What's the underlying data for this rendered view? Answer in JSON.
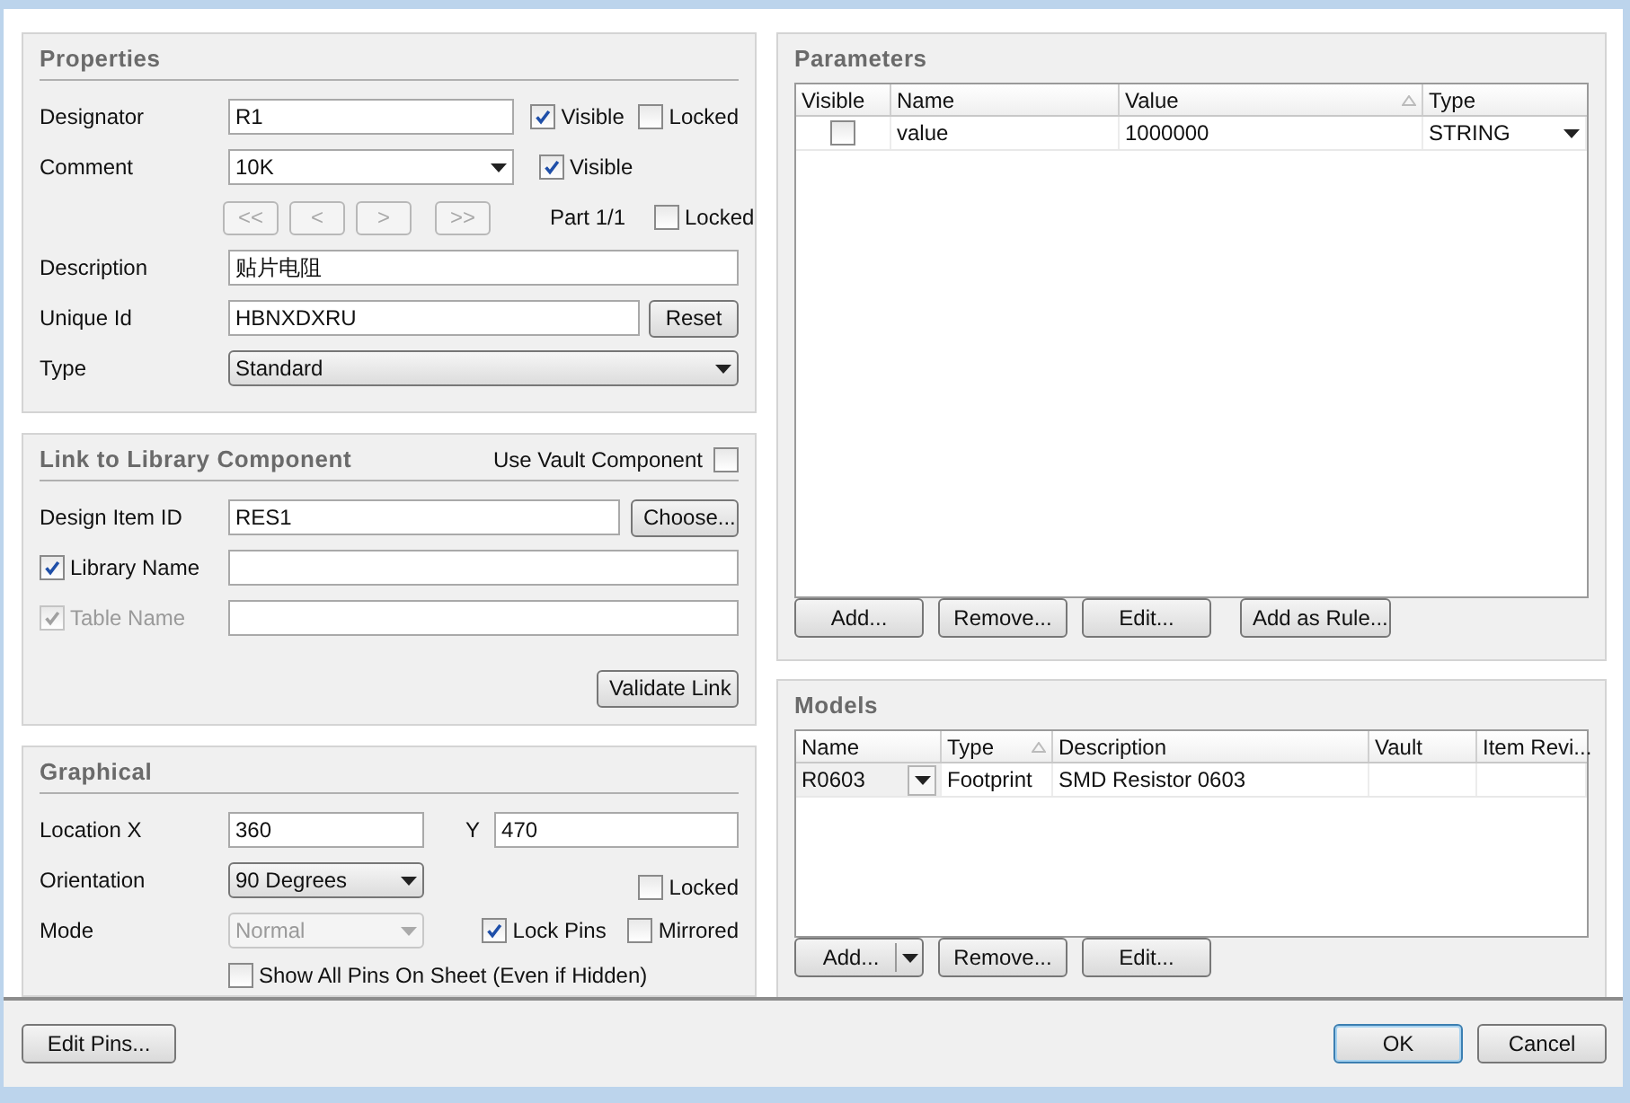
{
  "properties": {
    "title": "Properties",
    "designator": {
      "label": "Designator",
      "value": "R1"
    },
    "designator_visible": {
      "label": "Visible",
      "checked": true
    },
    "designator_locked": {
      "label": "Locked",
      "checked": false
    },
    "comment": {
      "label": "Comment",
      "value": "10K"
    },
    "comment_visible": {
      "label": "Visible",
      "checked": true
    },
    "part_buttons": [
      {
        "label": "<<",
        "disabled": true
      },
      {
        "label": "<",
        "disabled": true
      },
      {
        "label": ">",
        "disabled": true
      },
      {
        "label": ">>",
        "disabled": true
      }
    ],
    "part": "Part 1/1",
    "part_locked": {
      "label": "Locked",
      "checked": false
    },
    "description": {
      "label": "Description",
      "value": "贴片电阻"
    },
    "unique_id": {
      "label": "Unique Id",
      "value": "HBNXDXRU",
      "button": "Reset"
    },
    "type": {
      "label": "Type",
      "value": "Standard"
    }
  },
  "library_link": {
    "title": "Link to Library Component",
    "use_vault": {
      "label": "Use Vault Component",
      "checked": false
    },
    "design_item_id": {
      "label": "Design Item ID",
      "value": "RES1",
      "button": "Choose..."
    },
    "library_name": {
      "label": "Library Name",
      "checked": true
    },
    "table_name": {
      "label": "Table Name",
      "checked": true,
      "disabled": true
    },
    "validate_button": "Validate Link"
  },
  "graphical": {
    "title": "Graphical",
    "location_x": {
      "label": "Location X",
      "value": "360"
    },
    "location_y": {
      "label": "Y",
      "value": "470"
    },
    "orientation": {
      "label": "Orientation",
      "value": "90 Degrees"
    },
    "locked": {
      "label": "Locked",
      "checked": false
    },
    "mode": {
      "label": "Mode",
      "value": "Normal",
      "disabled": true
    },
    "lock_pins": {
      "label": "Lock Pins",
      "checked": true
    },
    "mirrored": {
      "label": "Mirrored",
      "checked": false
    },
    "show_all_pins": {
      "label": "Show All Pins On Sheet (Even if Hidden)",
      "checked": false
    }
  },
  "parameters": {
    "title": "Parameters",
    "columns": [
      {
        "label": "Visible",
        "sorted": false
      },
      {
        "label": "Name",
        "sorted": false
      },
      {
        "label": "Value",
        "sorted": true
      },
      {
        "label": "Type",
        "sorted": false
      }
    ],
    "rows": [
      {
        "visible": false,
        "name": "value",
        "value": "1000000",
        "type": "STRING"
      }
    ],
    "buttons": [
      "Add...",
      "Remove...",
      "Edit...",
      "Add as Rule..."
    ]
  },
  "models": {
    "title": "Models",
    "columns": [
      {
        "label": "Name",
        "sorted": false
      },
      {
        "label": "Type",
        "sorted": true
      },
      {
        "label": "Description",
        "sorted": false
      },
      {
        "label": "Vault",
        "sorted": false
      },
      {
        "label": "Item Revi...",
        "sorted": false
      }
    ],
    "rows": [
      {
        "name": "R0603",
        "type": "Footprint",
        "description": "SMD Resistor 0603"
      }
    ],
    "buttons": [
      {
        "label": "Add...",
        "split": true
      },
      {
        "label": "Remove...",
        "split": false
      },
      {
        "label": "Edit...",
        "split": false
      }
    ]
  },
  "footer": {
    "edit_pins": "Edit Pins...",
    "buttons": [
      {
        "label": "OK",
        "default": true
      },
      {
        "label": "Cancel",
        "default": false
      }
    ]
  }
}
